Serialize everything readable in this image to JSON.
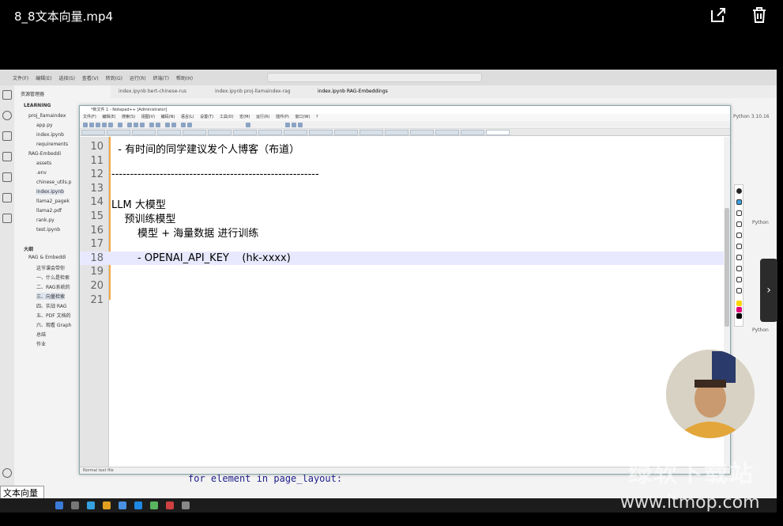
{
  "video": {
    "title": "8_8文本向量.mp4"
  },
  "vscode": {
    "menu": [
      "文件(F)",
      "编辑(E)",
      "选择(S)",
      "查看(V)",
      "转到(G)",
      "运行(R)",
      "终端(T)",
      "帮助(H)"
    ],
    "explorer_title": "资源管理器",
    "workspace": "LEARNING",
    "explorer_items": [
      "proj_llamaindex",
      "app.py",
      "index.ipynb",
      "requirements",
      "RAG-Embeddi",
      "assets",
      ".env",
      "chinese_utils.p",
      "index.ipynb",
      "llama2_pagek",
      "llama2.pdf",
      "rank.py",
      "test.ipynb"
    ],
    "outline_title": "大纲",
    "outline_items": [
      "RAG & Embeddi",
      "这节课会带你",
      "一、什么是检索",
      "二、RAG系统的",
      "三、向量检索",
      "四、实战 RAG",
      "五、PDF 文档的",
      "六、观看 Graph",
      "总结",
      "作业"
    ],
    "tabs": [
      "index.ipynb  bert-chinese-rus",
      "index.ipynb  proj-llamaindex-rag",
      "index.ipynb  RAG-Embeddings"
    ],
    "code_below": "for element in page_layout:",
    "python_version": "Python 3.10.16",
    "python_label": "Python"
  },
  "notepad": {
    "title": "*新文件 1 - Notepad++ [Administrator]",
    "menu": [
      "文件(F)",
      "编辑(E)",
      "搜索(S)",
      "视图(V)",
      "编码(N)",
      "语言(L)",
      "设置(T)",
      "工具(O)",
      "宏(M)",
      "运行(R)",
      "插件(P)",
      "窗口(W)",
      "?"
    ],
    "lines": [
      {
        "n": "10",
        "text": "  - 有时间的同学建议发个人博客（布道）"
      },
      {
        "n": "11",
        "text": ""
      },
      {
        "n": "12",
        "text": "--------------------------------------------------------"
      },
      {
        "n": "13",
        "text": ""
      },
      {
        "n": "14",
        "text": "LLM 大模型"
      },
      {
        "n": "15",
        "text": "    预训练模型"
      },
      {
        "n": "16",
        "text": "        模型 + 海量数据 进行训练"
      },
      {
        "n": "17",
        "text": ""
      },
      {
        "n": "18",
        "text": "        - OPENAI_API_KEY    (hk-xxxx)"
      },
      {
        "n": "19",
        "text": ""
      },
      {
        "n": "20",
        "text": ""
      },
      {
        "n": "21",
        "text": ""
      }
    ],
    "status": "Normal text file"
  },
  "subtitle": "文本向量",
  "watermark": "www.itmop.com"
}
